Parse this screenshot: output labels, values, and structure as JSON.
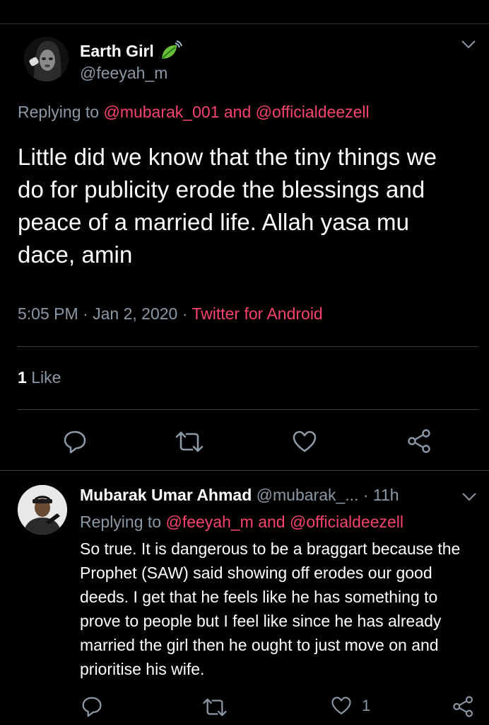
{
  "main_tweet": {
    "author_name": "Earth Girl",
    "author_handle": "@feeyah_m",
    "replying_prefix": "Replying to",
    "replying_user1": "@mubarak_001",
    "replying_and": "and",
    "replying_user2": "@officialdeezell",
    "text": "Little did we know that the tiny things we do for publicity erode the blessings and peace of a married life. Allah yasa mu dace, amin",
    "time": "5:05 PM",
    "date": "Jan 2, 2020",
    "client": "Twitter for Android",
    "likes_count": "1",
    "likes_label": "Like",
    "name_emoji_icon": "leaf-icon"
  },
  "reply_tweet": {
    "author_name": "Mubarak Umar Ahmad",
    "author_handle": "@mubarak_...",
    "separator": "·",
    "age": "11h",
    "replying_prefix": "Replying to",
    "replying_user1": "@feeyah_m",
    "replying_and": "and",
    "replying_user2": "@officialdeezell",
    "text": "So true. It is dangerous to be a braggart because the Prophet (SAW) said showing off erodes our good deeds. I get that he feels like he has something to prove to people but I feel like since he has already married the girl then he ought to just move on and prioritise his wife.",
    "like_count": "1"
  },
  "colors": {
    "background": "#000000",
    "text": "#ffffff",
    "secondary": "#8b98a5",
    "mention": "#f7436b",
    "divider": "#38444d"
  }
}
